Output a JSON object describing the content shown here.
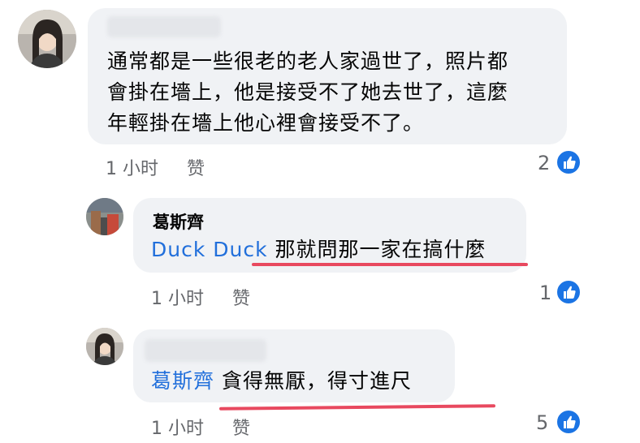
{
  "comments": [
    {
      "author": "",
      "lines": [
        "通常都是一些很老的老人家過世了，照片都",
        "會掛在墻上，他是接受不了她去世了，這麼",
        "年輕掛在墻上他心裡會接受不了。"
      ],
      "time": "1 小时",
      "like_label": "赞",
      "reactions": "2"
    },
    {
      "author": "葛斯齊",
      "mention": "Duck Duck",
      "text": "那就問那一家在搞什麼",
      "time": "1 小时",
      "like_label": "赞",
      "reactions": "1"
    },
    {
      "author": "",
      "mention": "葛斯齊",
      "text": "貪得無厭，得寸進尺",
      "time": "1 小时",
      "like_label": "赞",
      "reactions": "5"
    }
  ],
  "colors": {
    "bubble": "#f0f2f5",
    "mention": "#216fdb",
    "like_badge": "#1b74e4",
    "underline": "#e8495f",
    "meta": "#65676b"
  },
  "icons": {
    "reaction": "thumbs-up-icon",
    "avatar": "user-avatar"
  }
}
